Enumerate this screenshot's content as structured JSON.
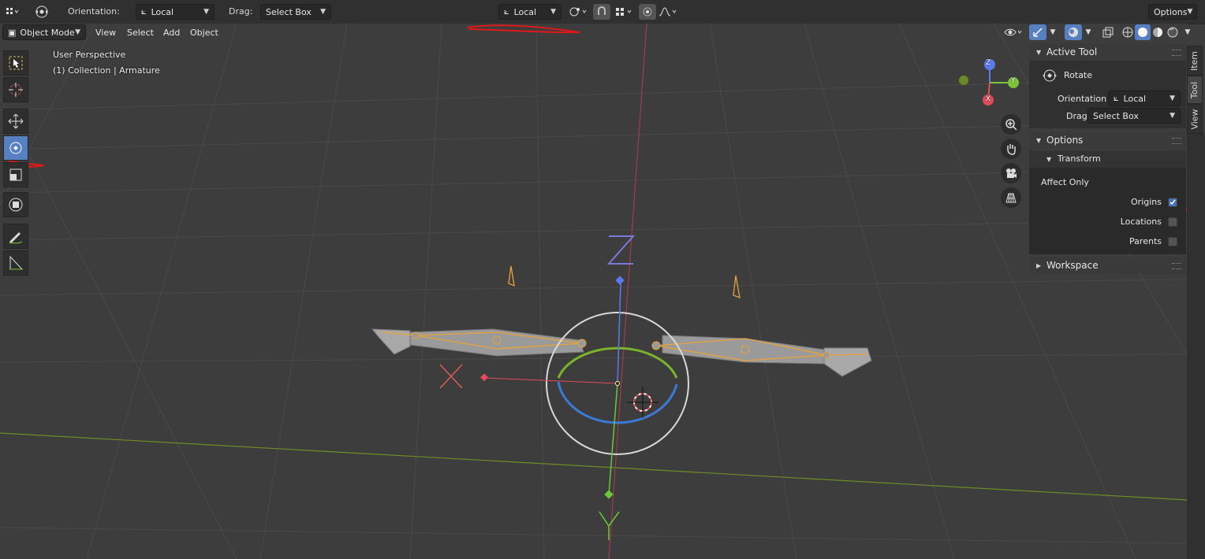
{
  "header": {
    "orientation_label": "Orientation:",
    "orientation_value": "Local",
    "drag_label": "Drag:",
    "drag_value": "Select Box",
    "pivot_value": "Local",
    "options_label": "Options"
  },
  "mode_bar": {
    "mode": "Object Mode",
    "menus": [
      "View",
      "Select",
      "Add",
      "Object"
    ]
  },
  "viewport": {
    "perspective": "User Perspective",
    "collection": "(1) Collection | Armature"
  },
  "gizmo": {
    "z": "Z",
    "y": "Y",
    "x": "X"
  },
  "gizmo_letters": {
    "z": "Z",
    "x": "X",
    "y": "Y"
  },
  "sidebar": {
    "active_tool_title": "Active Tool",
    "tool_name": "Rotate",
    "orientation_label": "Orientation",
    "orientation_value": "Local",
    "drag_label": "Drag:",
    "drag_value": "Select Box",
    "options_title": "Options",
    "transform_title": "Transform",
    "affect_only": "Affect Only",
    "origins": "Origins",
    "locations": "Locations",
    "parents": "Parents",
    "workspace_title": "Workspace",
    "checks": {
      "origins": true,
      "locations": false,
      "parents": false
    }
  },
  "tabs": {
    "item": "Item",
    "tool": "Tool",
    "view": "View"
  },
  "icons": [
    "editor-type-icon",
    "rotate-tool-icon",
    "orientation-icon",
    "pivot-icon",
    "snap-icon",
    "proportional-icon",
    "select-box-icon",
    "cursor-icon",
    "move-icon",
    "rotate-icon",
    "scale-icon",
    "transform-icon",
    "annotate-icon",
    "measure-icon",
    "zoom-icon",
    "pan-icon",
    "camera-icon",
    "grid-icon",
    "visibility-icon",
    "gizmo-icon",
    "overlay-icon",
    "xray-icon",
    "shading-wire-icon",
    "shading-solid-icon",
    "shading-material-icon",
    "shading-rendered-icon"
  ],
  "colors": {
    "accent": "#5680c2",
    "x_axis": "#e04b5a",
    "y_axis": "#7ac53a",
    "z_axis": "#5a7bf0",
    "bone": "#e8a33a"
  }
}
